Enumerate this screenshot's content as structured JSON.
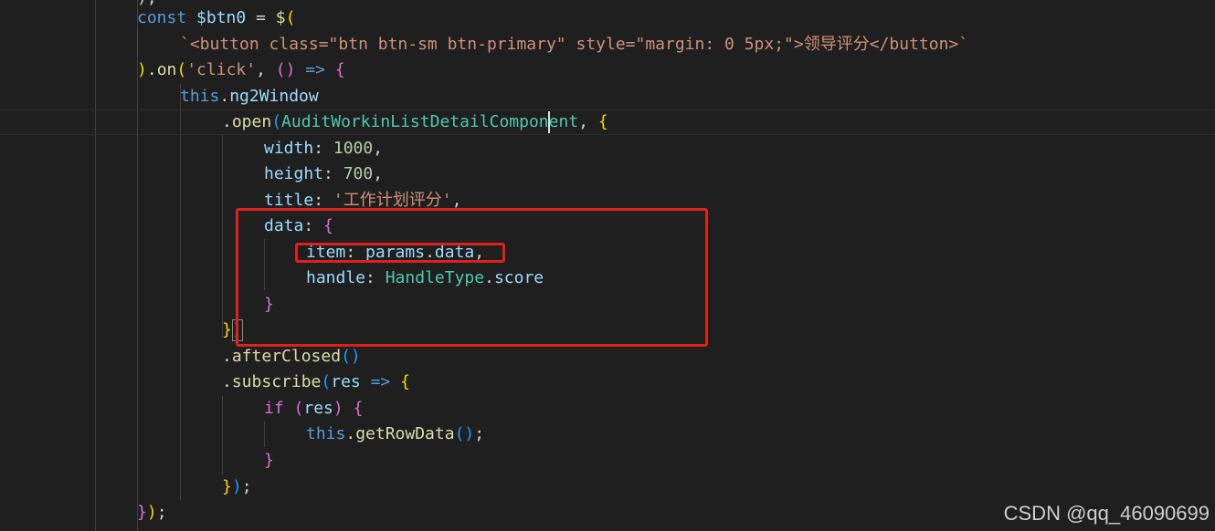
{
  "colors": {
    "background": "#1f1f1f",
    "keyword": "#569cd6",
    "variable": "#9cdcfe",
    "function": "#dcdcaa",
    "string": "#ce9178",
    "number": "#b5cea8",
    "type": "#4ec9b0",
    "bracket_gold": "#ffd700",
    "bracket_purple": "#da70d6",
    "bracket_blue": "#179fff",
    "plain": "#d4d4d4",
    "annotation": "#e0201c"
  },
  "code": {
    "top_stub": ");",
    "lines": [
      [
        {
          "t": "const ",
          "c": "keyword"
        },
        {
          "t": "$btn0",
          "c": "variable"
        },
        {
          "t": " = ",
          "c": "plain"
        },
        {
          "t": "$",
          "c": "function"
        },
        {
          "t": "(",
          "c": "bracket_gold"
        }
      ],
      [
        {
          "t": "`<button class=\"btn btn-sm btn-primary\" style=\"margin: 0 5px;\">领导评分</button>`",
          "c": "string"
        }
      ],
      [
        {
          "t": ")",
          "c": "bracket_gold"
        },
        {
          "t": ".",
          "c": "plain"
        },
        {
          "t": "on",
          "c": "function"
        },
        {
          "t": "(",
          "c": "bracket_gold"
        },
        {
          "t": "'click'",
          "c": "string"
        },
        {
          "t": ", ",
          "c": "plain"
        },
        {
          "t": "()",
          "c": "bracket_purple"
        },
        {
          "t": " => ",
          "c": "keyword"
        },
        {
          "t": "{",
          "c": "bracket_purple"
        }
      ],
      [
        {
          "t": "this",
          "c": "keyword"
        },
        {
          "t": ".",
          "c": "plain"
        },
        {
          "t": "ng2Window",
          "c": "variable"
        }
      ],
      [
        {
          "t": ".",
          "c": "plain"
        },
        {
          "t": "open",
          "c": "function"
        },
        {
          "t": "(",
          "c": "bracket_blue"
        },
        {
          "t": "AuditWorkinListDetailComponent",
          "c": "type"
        },
        {
          "t": ", ",
          "c": "plain"
        },
        {
          "t": "{",
          "c": "bracket_gold"
        }
      ],
      [
        {
          "t": "width",
          "c": "variable"
        },
        {
          "t": ": ",
          "c": "plain"
        },
        {
          "t": "1000",
          "c": "number"
        },
        {
          "t": ",",
          "c": "plain"
        }
      ],
      [
        {
          "t": "height",
          "c": "variable"
        },
        {
          "t": ": ",
          "c": "plain"
        },
        {
          "t": "700",
          "c": "number"
        },
        {
          "t": ",",
          "c": "plain"
        }
      ],
      [
        {
          "t": "title",
          "c": "variable"
        },
        {
          "t": ": ",
          "c": "plain"
        },
        {
          "t": "'工作计划评分'",
          "c": "string"
        },
        {
          "t": ",",
          "c": "plain"
        }
      ],
      [
        {
          "t": "data",
          "c": "variable"
        },
        {
          "t": ": ",
          "c": "plain"
        },
        {
          "t": "{",
          "c": "bracket_purple"
        }
      ],
      [
        {
          "t": "item",
          "c": "variable"
        },
        {
          "t": ": ",
          "c": "plain"
        },
        {
          "t": "params",
          "c": "variable"
        },
        {
          "t": ".",
          "c": "plain"
        },
        {
          "t": "data",
          "c": "variable"
        },
        {
          "t": ",",
          "c": "plain"
        }
      ],
      [
        {
          "t": "handle",
          "c": "variable"
        },
        {
          "t": ": ",
          "c": "plain"
        },
        {
          "t": "HandleType",
          "c": "type"
        },
        {
          "t": ".",
          "c": "plain"
        },
        {
          "t": "score",
          "c": "variable"
        }
      ],
      [
        {
          "t": "}",
          "c": "bracket_purple"
        }
      ],
      [
        {
          "t": "}",
          "c": "bracket_gold"
        },
        {
          "t": ")",
          "c": "bracket_blue"
        }
      ],
      [
        {
          "t": ".",
          "c": "plain"
        },
        {
          "t": "afterClosed",
          "c": "function"
        },
        {
          "t": "()",
          "c": "bracket_blue"
        }
      ],
      [
        {
          "t": ".",
          "c": "plain"
        },
        {
          "t": "subscribe",
          "c": "function"
        },
        {
          "t": "(",
          "c": "bracket_blue"
        },
        {
          "t": "res",
          "c": "variable"
        },
        {
          "t": " => ",
          "c": "keyword"
        },
        {
          "t": "{",
          "c": "bracket_gold"
        }
      ],
      [
        {
          "t": "if",
          "c": "bracket_purple"
        },
        {
          "t": " ",
          "c": "plain"
        },
        {
          "t": "(",
          "c": "bracket_purple"
        },
        {
          "t": "res",
          "c": "variable"
        },
        {
          "t": ")",
          "c": "bracket_purple"
        },
        {
          "t": " ",
          "c": "plain"
        },
        {
          "t": "{",
          "c": "bracket_purple"
        }
      ],
      [
        {
          "t": "this",
          "c": "keyword"
        },
        {
          "t": ".",
          "c": "plain"
        },
        {
          "t": "getRowData",
          "c": "function"
        },
        {
          "t": "()",
          "c": "bracket_blue"
        },
        {
          "t": ";",
          "c": "plain"
        }
      ],
      [
        {
          "t": "}",
          "c": "bracket_purple"
        }
      ],
      [
        {
          "t": "}",
          "c": "bracket_gold"
        },
        {
          "t": ")",
          "c": "bracket_blue"
        },
        {
          "t": ";",
          "c": "plain"
        }
      ],
      [
        {
          "t": "}",
          "c": "bracket_purple"
        },
        {
          "t": ")",
          "c": "bracket_gold"
        },
        {
          "t": ";",
          "c": "plain"
        }
      ]
    ]
  },
  "watermark": "CSDN @qq_46090699"
}
